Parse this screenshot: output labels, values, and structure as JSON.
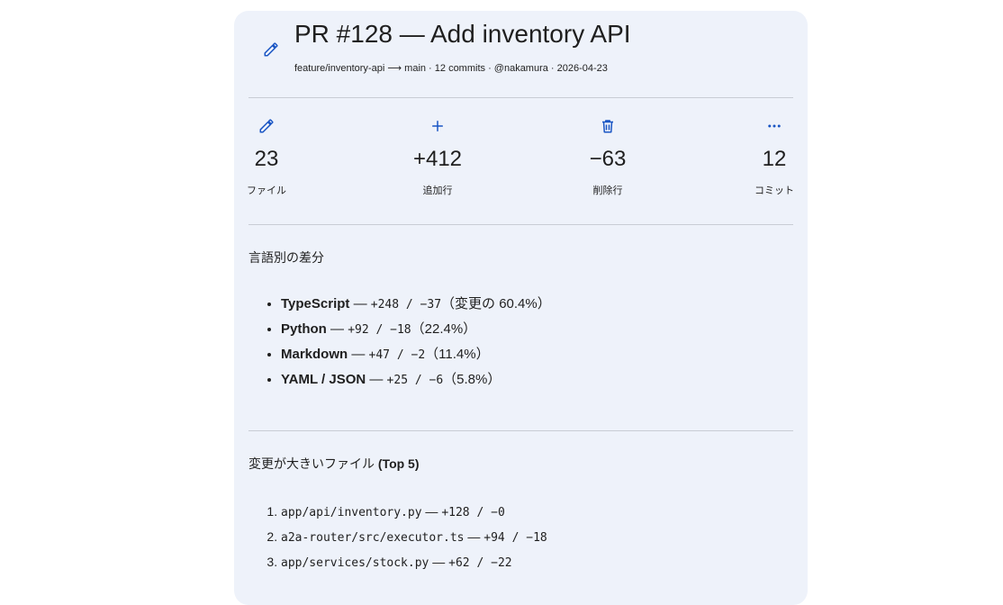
{
  "header": {
    "title": "PR #128 — Add inventory API",
    "meta": "feature/inventory-api ⟶ main · 12 commits · @nakamura · 2026-04-23"
  },
  "stats": [
    {
      "icon": "pencil-icon",
      "value": "23",
      "label": "ファイル"
    },
    {
      "icon": "plus-icon",
      "value": "+412",
      "label": "追加行"
    },
    {
      "icon": "trash-icon",
      "value": "−63",
      "label": "削除行"
    },
    {
      "icon": "more-horizontal-icon",
      "value": "12",
      "label": "コミット"
    }
  ],
  "languages": {
    "title": "言語別の差分",
    "items": [
      {
        "name": "TypeScript",
        "sep": " — ",
        "diff": "+248 / −37",
        "note": "（変更の 60.4%）"
      },
      {
        "name": "Python",
        "sep": " — ",
        "diff": "+92 / −18",
        "note": "（22.4%）"
      },
      {
        "name": "Markdown",
        "sep": " — ",
        "diff": "+47 / −2",
        "note": "（11.4%）"
      },
      {
        "name": "YAML / JSON",
        "sep": " — ",
        "diff": "+25 / −6",
        "note": "（5.8%）"
      }
    ]
  },
  "files": {
    "title_prefix": "変更が大きいファイル",
    "title_suffix": "(Top 5)",
    "items": [
      {
        "path": "app/api/inventory.py",
        "sep": " — ",
        "diff": "+128 / −0"
      },
      {
        "path": "a2a-router/src/executor.ts",
        "sep": " — ",
        "diff": "+94 / −18"
      },
      {
        "path": "app/services/stock.py",
        "sep": " — ",
        "diff": "+62 / −22"
      }
    ]
  },
  "colors": {
    "accent": "#1a56c4",
    "card_bg": "#eef2fa",
    "divider": "#c8ccd4"
  }
}
